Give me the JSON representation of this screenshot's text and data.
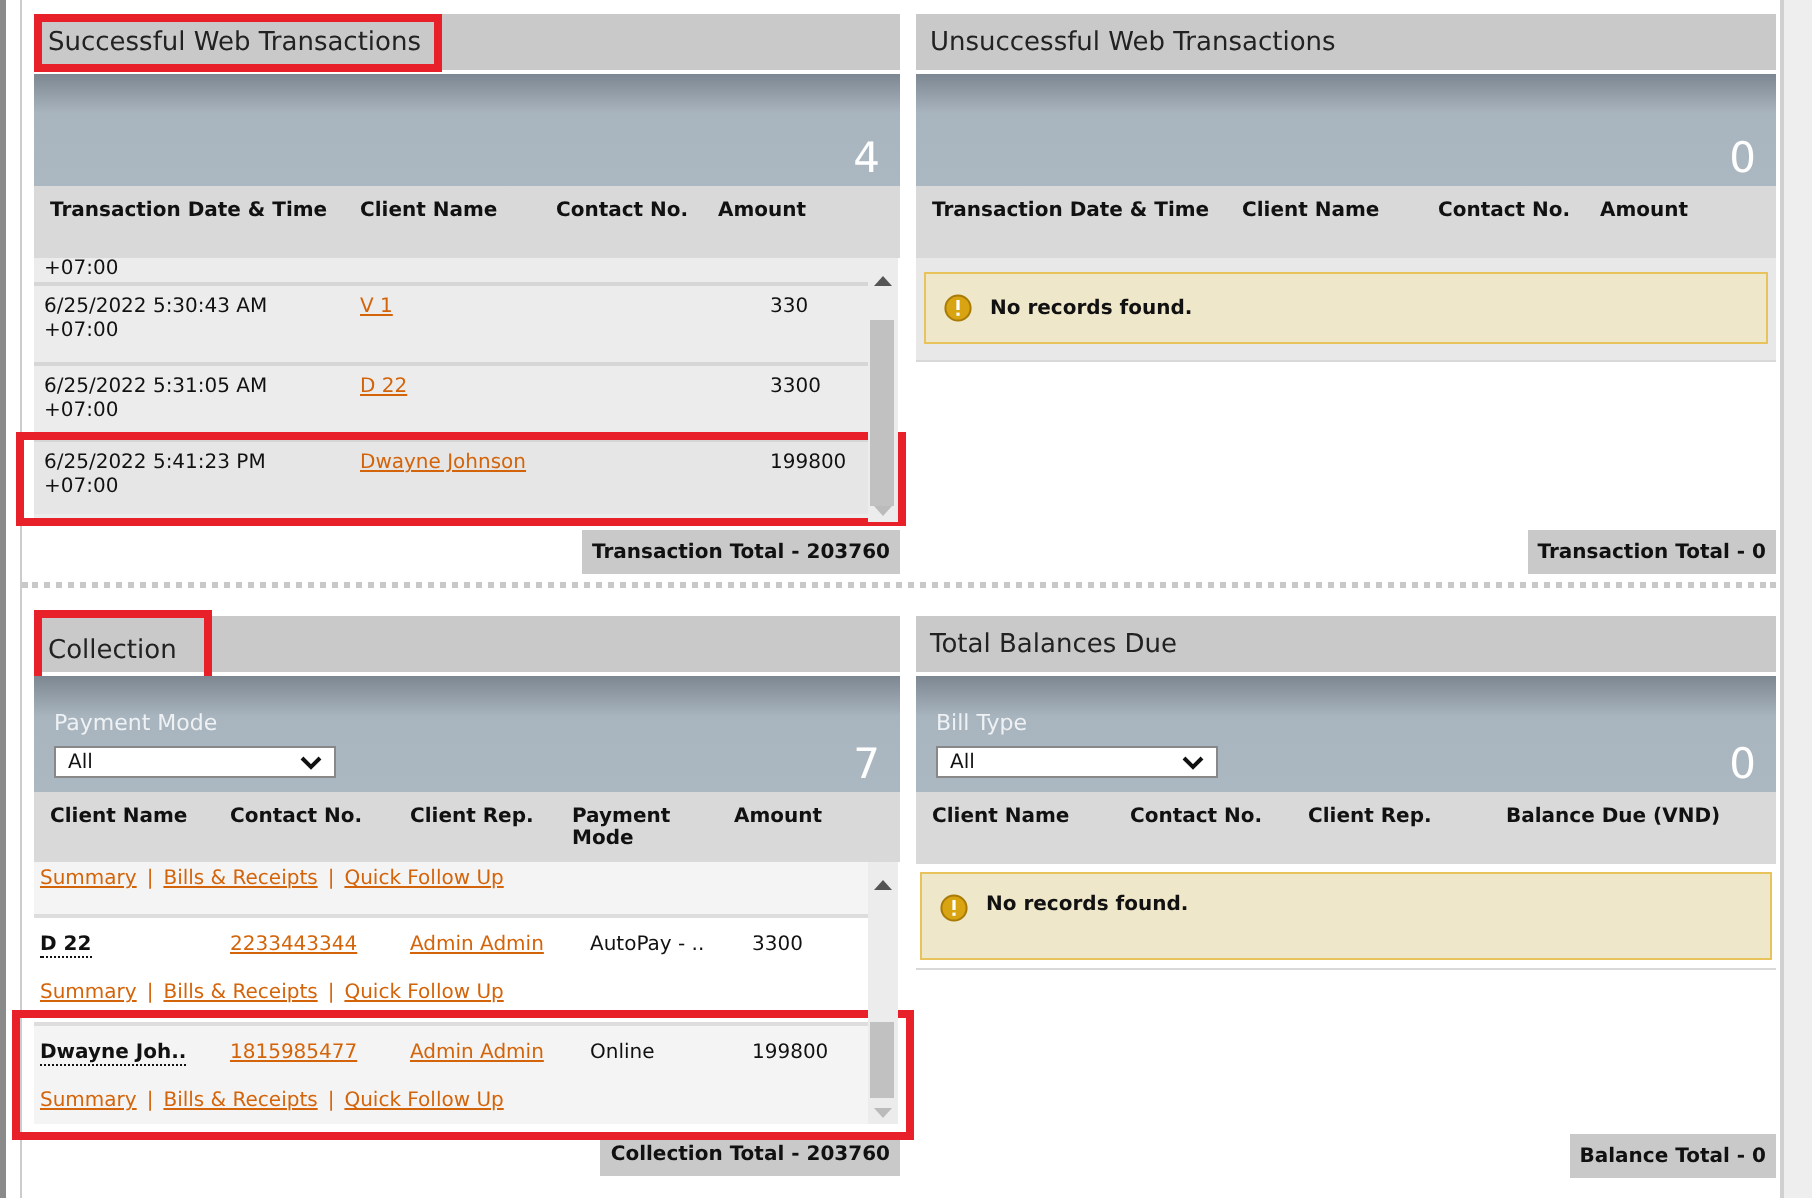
{
  "panels": [
    {
      "kind": "transactions",
      "title": "Successful Web Transactions",
      "title_highlighted": true,
      "count": "4",
      "columns": [
        "Transaction Date & Time",
        "Client Name",
        "Contact No.",
        "Amount"
      ],
      "rows": [
        {
          "offset": "+07:00",
          "highlighted": false
        },
        {
          "date": "6/25/2022 5:30:43 AM",
          "offset": "+07:00",
          "client": "V 1",
          "amount": "330",
          "highlighted": false
        },
        {
          "date": "6/25/2022 5:31:05 AM",
          "offset": "+07:00",
          "client": "D 22",
          "amount": "3300",
          "highlighted": false
        },
        {
          "date": "6/25/2022 5:41:23 PM",
          "offset": "+07:00",
          "client": "Dwayne Johnson",
          "amount": "199800",
          "highlighted": true
        }
      ],
      "total": "Transaction Total - 203760"
    },
    {
      "kind": "transactions",
      "title": "Unsuccessful Web Transactions",
      "title_highlighted": false,
      "count": "0",
      "columns": [
        "Transaction Date & Time",
        "Client Name",
        "Contact No.",
        "Amount"
      ],
      "message": "No records found.",
      "total": "Transaction Total - 0"
    },
    {
      "kind": "collection",
      "title": "Collection",
      "title_highlighted": true,
      "filter": {
        "label": "Payment Mode",
        "value": "All"
      },
      "count": "7",
      "columns": [
        "Client Name",
        "Contact No.",
        "Client Rep.",
        "Payment Mode",
        "Amount"
      ],
      "rows": [
        {
          "links": [
            {
              "kind": "link",
              "text": "Summary"
            },
            {
              "kind": "separator",
              "text": "|"
            },
            {
              "kind": "link",
              "text": "Bills & Receipts"
            },
            {
              "kind": "separator",
              "text": "|"
            },
            {
              "kind": "link",
              "text": "Quick Follow Up"
            }
          ],
          "highlighted": false
        },
        {
          "name": "D 22",
          "contact": "2233443344",
          "rep": "Admin Admin",
          "mode": "AutoPay - ..",
          "amount": "3300",
          "links": [
            {
              "kind": "link",
              "text": "Summary"
            },
            {
              "kind": "separator",
              "text": "|"
            },
            {
              "kind": "link",
              "text": "Bills & Receipts"
            },
            {
              "kind": "separator",
              "text": "|"
            },
            {
              "kind": "link",
              "text": "Quick Follow Up"
            }
          ],
          "highlighted": false
        },
        {
          "name": "Dwayne Joh..",
          "contact": "1815985477",
          "rep": "Admin Admin",
          "mode": "Online",
          "amount": "199800",
          "links": [
            {
              "kind": "link",
              "text": "Summary"
            },
            {
              "kind": "separator",
              "text": "|"
            },
            {
              "kind": "link",
              "text": "Bills & Receipts"
            },
            {
              "kind": "separator",
              "text": "|"
            },
            {
              "kind": "link",
              "text": "Quick Follow Up"
            }
          ],
          "highlighted": true
        }
      ],
      "total": "Collection Total - 203760"
    },
    {
      "kind": "balances",
      "title": "Total Balances Due",
      "title_highlighted": false,
      "filter": {
        "label": "Bill Type",
        "value": "All"
      },
      "count": "0",
      "columns": [
        "Client Name",
        "Contact No.",
        "Client Rep.",
        "Balance Due (VND)"
      ],
      "message": "No records found.",
      "total": "Balance Total - 0"
    }
  ]
}
